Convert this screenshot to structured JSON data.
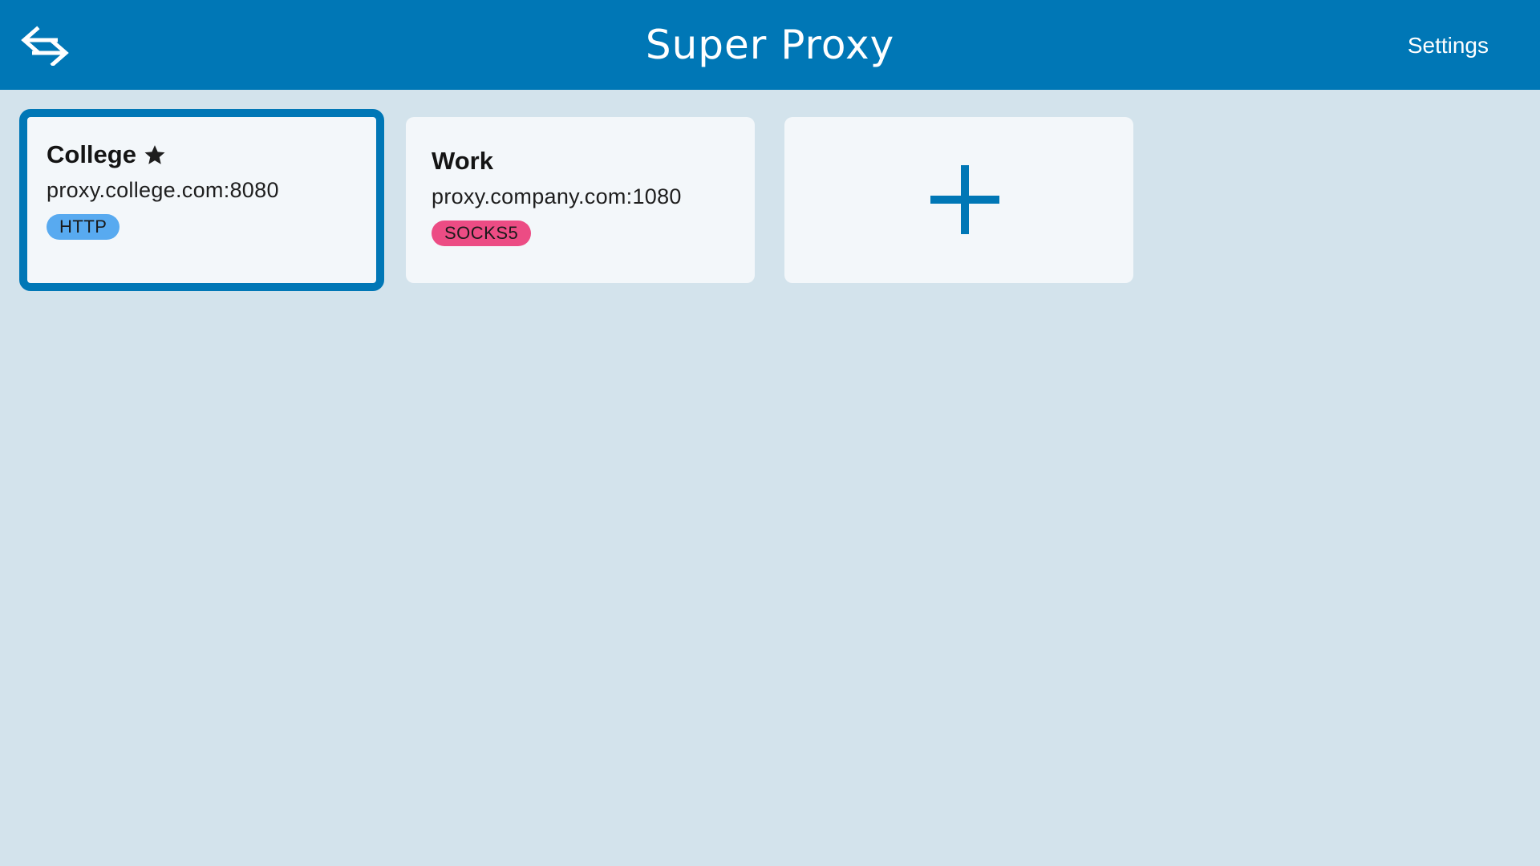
{
  "header": {
    "title": "Super Proxy",
    "settings_label": "Settings",
    "app_icon": "swap-arrows-icon",
    "background_color": "#0077b6"
  },
  "proxies": [
    {
      "name": "College",
      "favorite": true,
      "favorite_icon": "star-icon",
      "address": "proxy.college.com:8080",
      "protocol": "HTTP",
      "protocol_color": "#58aaf0",
      "selected": true
    },
    {
      "name": "Work",
      "favorite": false,
      "address": "proxy.company.com:1080",
      "protocol": "SOCKS5",
      "protocol_color": "#ec4c84",
      "selected": false
    }
  ],
  "add_card": {
    "icon": "plus-icon"
  },
  "colors": {
    "accent": "#0077b6",
    "page_background": "#d3e3ec",
    "card_background": "#f3f7fa"
  }
}
